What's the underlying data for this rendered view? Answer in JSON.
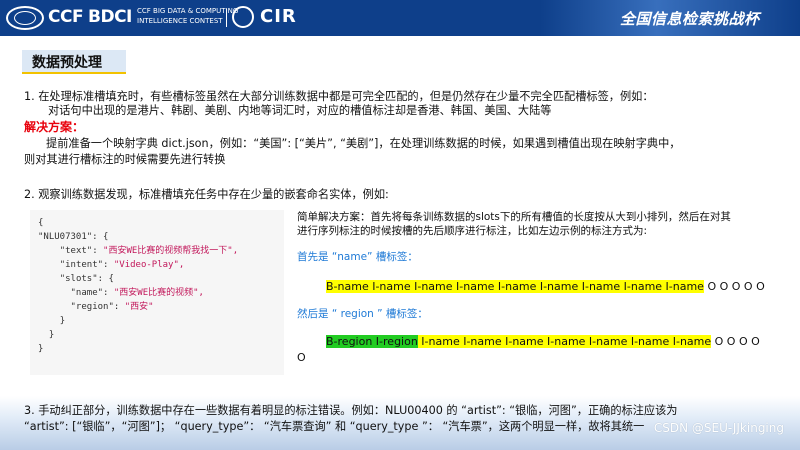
{
  "header": {
    "logo_ccf": "CCF",
    "logo_bdci": "BDCI",
    "bdci_sub_1": "CCF BIG DATA & COMPUTING",
    "bdci_sub_2": "INTELLIGENCE CONTEST",
    "logo_cir": "CIR",
    "contest_name": "全国信息检索挑战杯"
  },
  "slide": {
    "title": "数据预处理",
    "item1_line1": "1.    在处理标准槽填充时，有些槽标签虽然在大部分训练数据中都是可完全匹配的，但是仍然存在少量不完全匹配槽标签，例如：",
    "item1_line2": "对话句中出现的是港片、韩剧、美剧、内地等词汇时，对应的槽值标注却是香港、韩国、美国、大陆等",
    "solution_label": "解决方案：",
    "solution_line1": "提前准备一个映射字典  dict.json，例如：“美国”: [“美片”, “美剧”]，在处理训练数据的时候，如果遇到槽值出现在映射字典中，",
    "solution_line2": "则对其进行槽标注的时候需要先进行转换",
    "item2": "2.    观察训练数据发现，标准槽填充任务中存在少量的嵌套命名实体，例如:",
    "side_line1": "简单解决方案：首先将每条训练数据的slots下的所有槽值的长度按从大到小排列，然后在对其",
    "side_line2": "进行序列标注的时候按槽的先后顺序进行标注，比如左边示例的标注方式为:",
    "first_label": "首先是 “name” 槽标签：",
    "name_tags": "B-name I-name I-name I-name I-name I-name I-name I-name I-name",
    "name_tail": " O O O O O",
    "then_label": "然后是 “ region ” 槽标签：",
    "region_tags": "B-region I-region",
    "region_mid": " I-name I-name I-name I-name I-name I-name I-name",
    "region_tail": " O O O O",
    "region_wrap": "O",
    "item3_line1": "3.   手动纠正部分，训练数据中存在一些数据有着明显的标注错误。例如：NLU00400  的 “artist”: “银临，河图”，正确的标注应该为",
    "item3_line2": "“artist”: [“银临”，“河图”]；  “query_type”：  “汽车票查询” 和 “query_type ”：  “汽车票”，这两个明显一样，故将其统一",
    "watermark": "CSDN @SEU-JJkinging"
  },
  "code": {
    "l1": "{",
    "l2_key": "\"NLU07301\": {",
    "l3_key": "\"text\": ",
    "l3_val": "\"西安WE比赛的视频帮我找一下\",",
    "l4_key": "\"intent\": ",
    "l4_val": "\"Video-Play\",",
    "l5_key": "\"slots\": {",
    "l6_key": "\"name\": ",
    "l6_val": "\"西安WE比赛的视频\",",
    "l7_key": "\"region\": ",
    "l7_val": "\"西安\"",
    "l8": "}",
    "l9": "}",
    "l10": "}"
  },
  "colors": {
    "header_bg": "#0e3f8a",
    "accent_red": "#e8000b",
    "accent_blue": "#1f7ad6",
    "highlight_yellow": "#ffff00",
    "highlight_green": "#22cc22"
  }
}
